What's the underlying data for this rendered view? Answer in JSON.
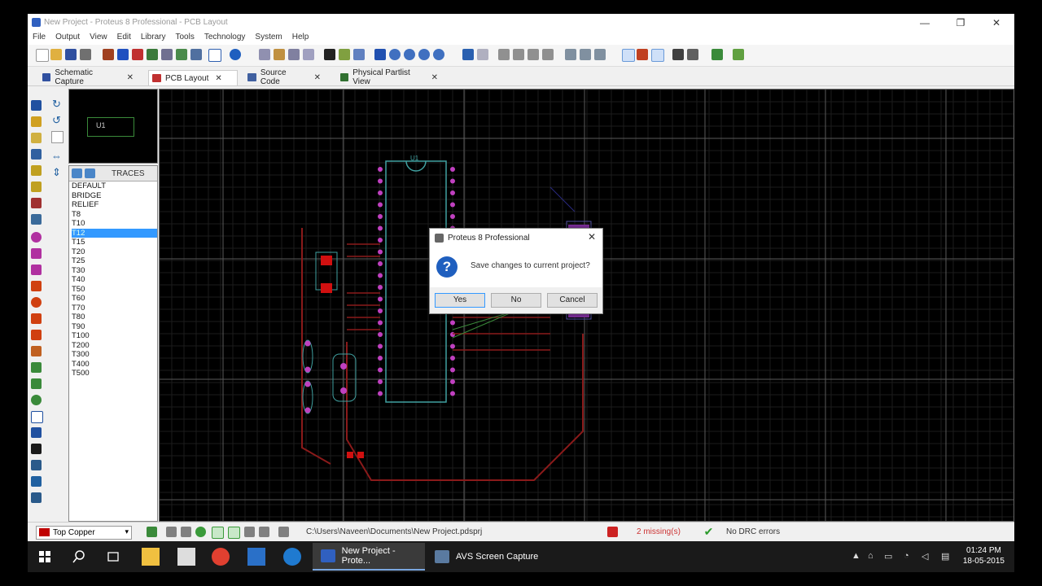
{
  "window": {
    "title": "New Project - Proteus 8 Professional - PCB Layout",
    "controls": {
      "minimize": "—",
      "maximize": "❐",
      "close": "✕"
    }
  },
  "menu": [
    "File",
    "Output",
    "View",
    "Edit",
    "Library",
    "Tools",
    "Technology",
    "System",
    "Help"
  ],
  "tabs": [
    {
      "label": "Schematic Capture",
      "close": "✕",
      "icon_color": "#3050a0"
    },
    {
      "label": "PCB Layout",
      "close": "✕",
      "icon_color": "#c03030"
    },
    {
      "label": "Source Code",
      "close": "✕",
      "icon_color": "#4060a0"
    },
    {
      "label": "Physical Partlist View",
      "close": "✕",
      "icon_color": "#307030"
    }
  ],
  "preview": {
    "label": "U1"
  },
  "traces_panel": {
    "title": "TRACES",
    "items": [
      "DEFAULT",
      "BRIDGE",
      "RELIEF",
      "T8",
      "T10",
      "T12",
      "T15",
      "T20",
      "T25",
      "T30",
      "T40",
      "T50",
      "T60",
      "T70",
      "T80",
      "T90",
      "T100",
      "T200",
      "T300",
      "T400",
      "T500"
    ],
    "selected_index": 5
  },
  "pcb": {
    "component_label": "U1",
    "colors": {
      "grid": "#5a5a5a",
      "pad": "#c040c0",
      "copper": "#8a1a1a",
      "outline": "#40a0a0",
      "smd": "#d01010"
    }
  },
  "dialog": {
    "title": "Proteus 8 Professional",
    "close": "✕",
    "icon": "?",
    "message": "Save changes to current project?",
    "buttons": {
      "yes": "Yes",
      "no": "No",
      "cancel": "Cancel"
    }
  },
  "statusbar": {
    "layer": "Top Copper",
    "dropdown": "▾",
    "path": "C:\\Users\\Naveen\\Documents\\New Project.pdsprj",
    "missing": "2 missing(s)",
    "drc": "No DRC errors"
  },
  "taskbar": {
    "items": [
      {
        "label": "New Project - Prote...",
        "active": true
      },
      {
        "label": "AVS Screen Capture",
        "active": false
      }
    ],
    "time": "01:24 PM",
    "date": "18-05-2015"
  }
}
